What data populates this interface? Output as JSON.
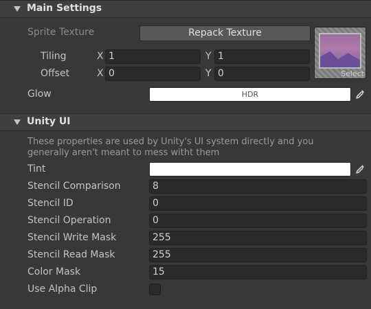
{
  "main_settings": {
    "title": "Main Settings",
    "sprite_texture_label": "Sprite Texture",
    "repack_button": "Repack Texture",
    "texture_select_label": "Select",
    "tiling_label": "Tiling",
    "tiling_x_axis": "X",
    "tiling_x": "1",
    "tiling_y_axis": "Y",
    "tiling_y": "1",
    "offset_label": "Offset",
    "offset_x_axis": "X",
    "offset_x": "0",
    "offset_y_axis": "Y",
    "offset_y": "0",
    "glow_label": "Glow",
    "glow_badge": "HDR"
  },
  "unity_ui": {
    "title": "Unity UI",
    "description": "These properties are used by Unity's UI system directly and you generally aren't meant to mess witht them",
    "tint_label": "Tint",
    "stencil_comparison_label": "Stencil Comparison",
    "stencil_comparison": "8",
    "stencil_id_label": "Stencil ID",
    "stencil_id": "0",
    "stencil_operation_label": "Stencil Operation",
    "stencil_operation": "0",
    "stencil_write_mask_label": "Stencil Write Mask",
    "stencil_write_mask": "255",
    "stencil_read_mask_label": "Stencil Read Mask",
    "stencil_read_mask": "255",
    "color_mask_label": "Color Mask",
    "color_mask": "15",
    "use_alpha_clip_label": "Use Alpha Clip",
    "use_alpha_clip": false
  },
  "icons": {
    "foldout": "triangle-down-icon",
    "eyedropper": "eyedropper-icon"
  },
  "colors": {
    "glow": "#ffffff",
    "tint": "#ffffff"
  }
}
